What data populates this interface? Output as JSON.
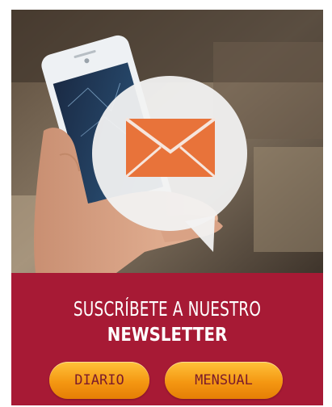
{
  "newsletter": {
    "headline_line1": "SUSCRÍBETE A NUESTRO",
    "headline_line2": "NEWSLETTER",
    "buttons": {
      "daily_label": "DIARIO",
      "monthly_label": "MENSUAL"
    }
  },
  "colors": {
    "panel_background": "#a71a35",
    "button_orange": "#f49712",
    "envelope_orange": "#e8733a",
    "bubble_white": "#f2f2f2"
  },
  "icons": [
    "envelope-icon",
    "speech-bubble-icon"
  ]
}
